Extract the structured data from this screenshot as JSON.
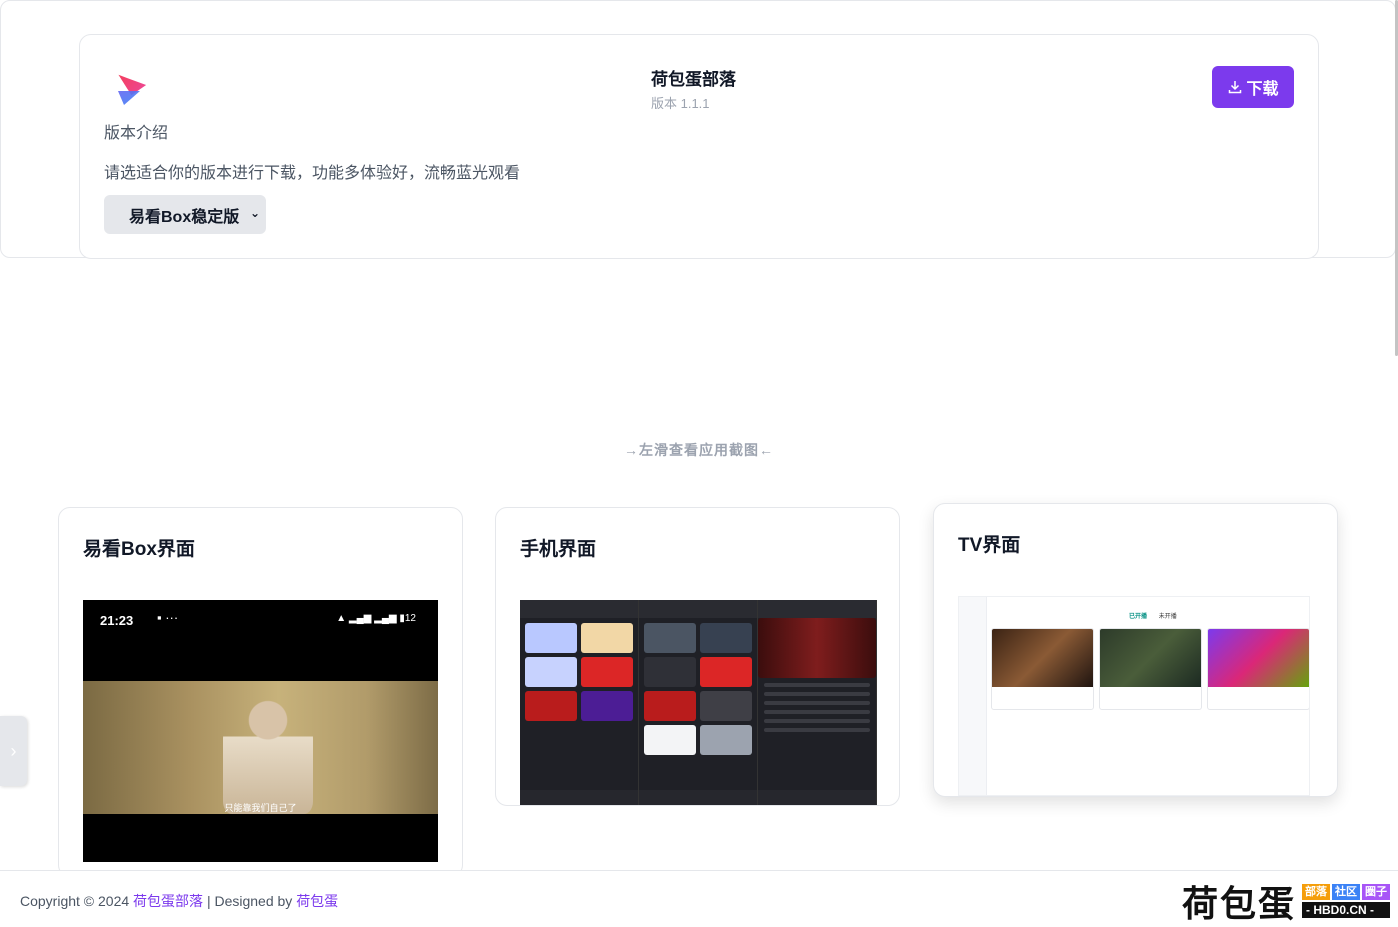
{
  "header": {
    "intro_label": "版本介绍",
    "app_name": "荷包蛋部落",
    "app_version": "版本 1.1.1",
    "download_label": "下载",
    "description": "请选适合你的版本进行下载，功能多体验好，流畅蓝光观看",
    "selected_version": "易看Box稳定版",
    "accent_color": "#7c3aed"
  },
  "gallery": {
    "hint": "→左滑查看应用截图←",
    "cards": [
      {
        "title": "易看Box界面"
      },
      {
        "title": "手机界面"
      },
      {
        "title": "TV界面"
      }
    ],
    "phone_shot": {
      "clock": "21:23",
      "subtitle": "只能靠我们自己了"
    },
    "tv_shot": {
      "tab_active": "已开播",
      "tab_other": "未开播"
    }
  },
  "footer": {
    "copyright_prefix": "Copyright © 2024",
    "site_link": "荷包蛋部落",
    "designed_by": "| Designed by",
    "designer_link": "荷包蛋"
  },
  "brand": {
    "name": "荷包蛋",
    "tag1": "部落",
    "tag2": "社区",
    "tag3": "圈子",
    "domain": "- HBD0.CN -"
  }
}
